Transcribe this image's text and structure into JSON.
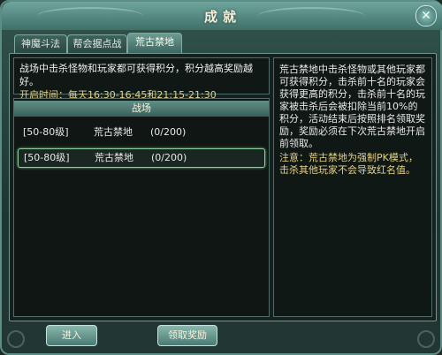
{
  "window": {
    "title": "成就",
    "close_label": "✕"
  },
  "tabs": [
    {
      "label": "神魔斗法",
      "active": false
    },
    {
      "label": "帮会据点战",
      "active": false
    },
    {
      "label": "荒古禁地",
      "active": true
    }
  ],
  "info": {
    "line1": "战场中击杀怪物和玩家都可获得积分，积分越高奖励越好。",
    "line2": "开启时间：每天16:30-16:45和21:15-21:30"
  },
  "table": {
    "header": "战场",
    "rows": [
      {
        "level": "[50-80级]",
        "name": "荒古禁地",
        "count": "(0/200)",
        "selected": false
      },
      {
        "level": "[50-80级]",
        "name": "荒古禁地",
        "count": "(0/200)",
        "selected": true
      }
    ]
  },
  "description": {
    "text": "荒古禁地中击杀怪物或其他玩家都可获得积分，击杀前十名的玩家会获得更高的积分，击杀前十名的玩家被击杀后会被扣除当前10%的积分，活动结束后按照排名领取奖励，奖励必须在下次荒古禁地开启前领取。",
    "note": "注意：荒古禁地为强制PK模式，击杀其他玩家不会导致红名值。"
  },
  "buttons": {
    "enter": "进入",
    "claim": "领取奖励"
  }
}
